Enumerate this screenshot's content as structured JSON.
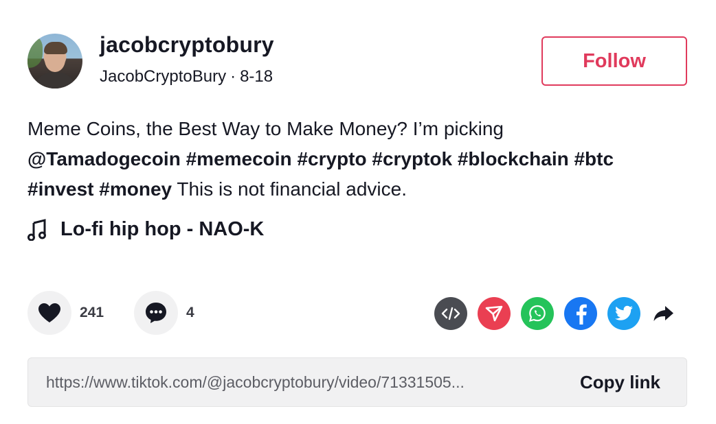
{
  "author": {
    "username": "jacobcryptobury",
    "display_name": "JacobCryptoBury",
    "separator": "·",
    "date": "8-18"
  },
  "follow_label": "Follow",
  "caption": {
    "line1_text": "Meme Coins, the Best Way to Make Money? I’m picking",
    "mention": "@Tamadogecoin",
    "hashtags_line2": "#memecoin #crypto #cryptok #blockchain #btc",
    "hashtags_line3": "#invest #money",
    "tail": " This is not financial advice."
  },
  "music": {
    "icon": "music-note-icon",
    "title": "Lo-fi hip hop - NAO-K"
  },
  "actions": {
    "likes": "241",
    "comments": "4"
  },
  "share": {
    "icons": [
      "embed-icon",
      "send-icon",
      "whatsapp-icon",
      "facebook-icon",
      "twitter-icon",
      "share-arrow-icon"
    ],
    "colors": {
      "embed": "#4a4c52",
      "send": "#ea3f52",
      "whatsapp": "#25c35a",
      "facebook": "#1877f2",
      "twitter": "#1da1f2"
    }
  },
  "link_bar": {
    "url": "https://www.tiktok.com/@jacobcryptobury/video/71331505...",
    "copy_label": "Copy link"
  },
  "colors": {
    "accent": "#e03a5c",
    "text": "#161823",
    "muted": "#5c5d64",
    "surface": "#f1f1f2"
  }
}
